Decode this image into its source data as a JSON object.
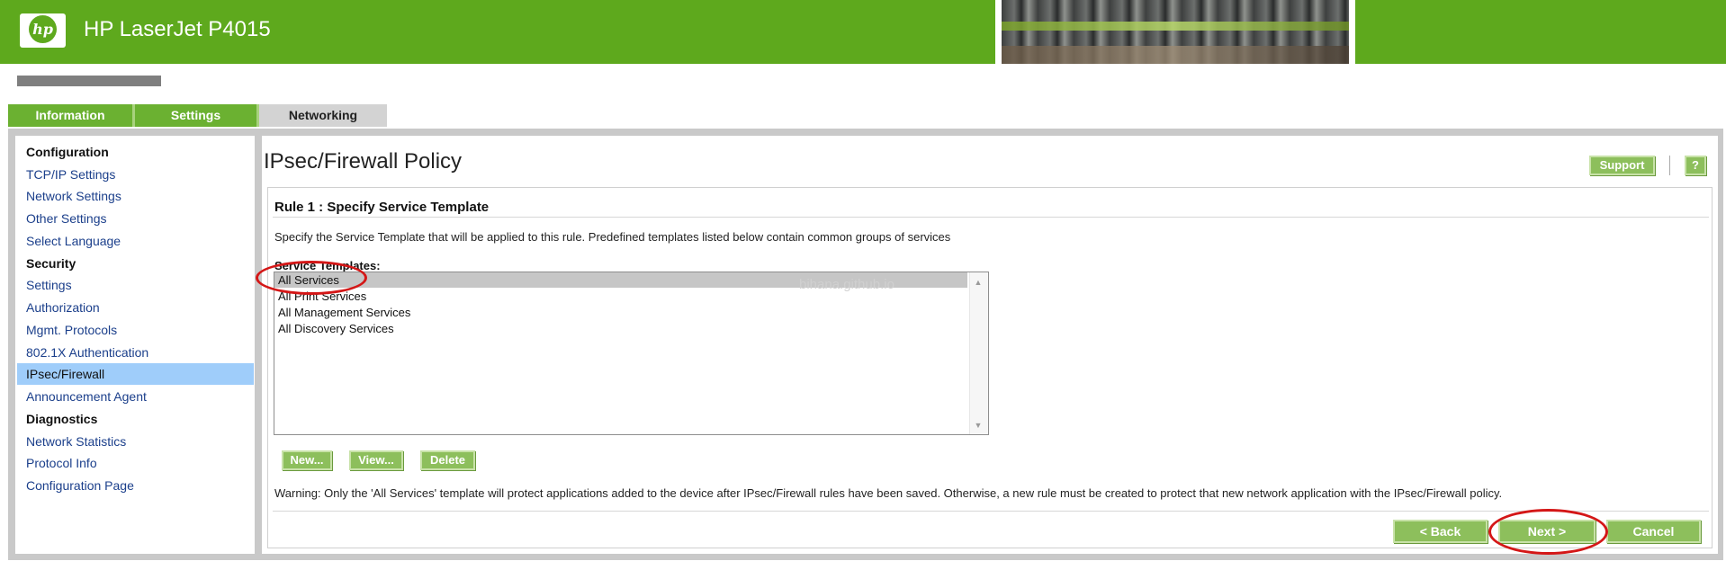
{
  "header": {
    "logo_text": "hp",
    "product": "HP LaserJet P4015"
  },
  "tabs": [
    {
      "label": "Information",
      "active": false
    },
    {
      "label": "Settings",
      "active": false
    },
    {
      "label": "Networking",
      "active": true
    }
  ],
  "sidebar": {
    "items": [
      {
        "type": "heading",
        "label": "Configuration"
      },
      {
        "type": "link",
        "label": "TCP/IP Settings"
      },
      {
        "type": "link",
        "label": "Network Settings"
      },
      {
        "type": "link",
        "label": "Other Settings"
      },
      {
        "type": "link",
        "label": "Select Language"
      },
      {
        "type": "heading",
        "label": "Security"
      },
      {
        "type": "link",
        "label": "Settings"
      },
      {
        "type": "link",
        "label": "Authorization"
      },
      {
        "type": "link",
        "label": "Mgmt. Protocols"
      },
      {
        "type": "link",
        "label": "802.1X Authentication"
      },
      {
        "type": "link",
        "label": "IPsec/Firewall",
        "selected": true
      },
      {
        "type": "link",
        "label": "Announcement Agent"
      },
      {
        "type": "heading",
        "label": "Diagnostics"
      },
      {
        "type": "link",
        "label": "Network Statistics"
      },
      {
        "type": "link",
        "label": "Protocol Info"
      },
      {
        "type": "link",
        "label": "Configuration Page"
      }
    ]
  },
  "main": {
    "title": "IPsec/Firewall Policy",
    "support_label": "Support",
    "help_label": "?",
    "rule_title": "Rule 1 : Specify Service Template",
    "description": "Specify the Service Template that will be applied to this rule. Predefined templates listed below contain common groups of services",
    "templates_label": "Service Templates:",
    "templates": [
      "All Services",
      "All Print Services",
      "All Management Services",
      "All Discovery Services"
    ],
    "selected_template": "All Services",
    "new_label": "New...",
    "view_label": "View...",
    "delete_label": "Delete",
    "warning": "Warning: Only the 'All Services' template will protect applications added to the device after IPsec/Firewall rules have been saved. Otherwise, a new rule must be created to protect that new network application with the IPsec/Firewall policy.",
    "back_label": "< Back",
    "next_label": "Next >",
    "cancel_label": "Cancel"
  },
  "watermark": "bihana.github.io",
  "colors": {
    "header_green": "#5ea91d",
    "button_green": "#8dbf5c",
    "selection_blue": "#9fcdfa",
    "annotation_red": "#d41717"
  }
}
